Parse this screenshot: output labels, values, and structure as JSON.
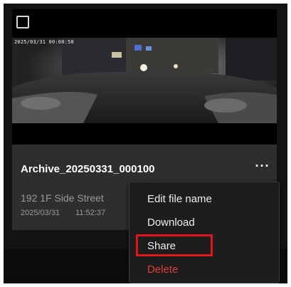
{
  "card": {
    "timestamp_overlay": "2025/03/31 00:00:58",
    "file_name": "Archive_20250331_000100",
    "location": "192 1F Side Street",
    "date": "2025/03/31",
    "time": "11:52:37",
    "more_icon": "more-horizontal-icon",
    "more_glyph": "···"
  },
  "context_menu": {
    "items": [
      {
        "label": "Edit file name",
        "color": "#eeeeee"
      },
      {
        "label": "Download",
        "color": "#eeeeee"
      },
      {
        "label": "Share",
        "color": "#eeeeee",
        "highlighted": true
      },
      {
        "label": "Delete",
        "color": "#e23b3b"
      }
    ],
    "highlight_color": "#e0141b"
  }
}
